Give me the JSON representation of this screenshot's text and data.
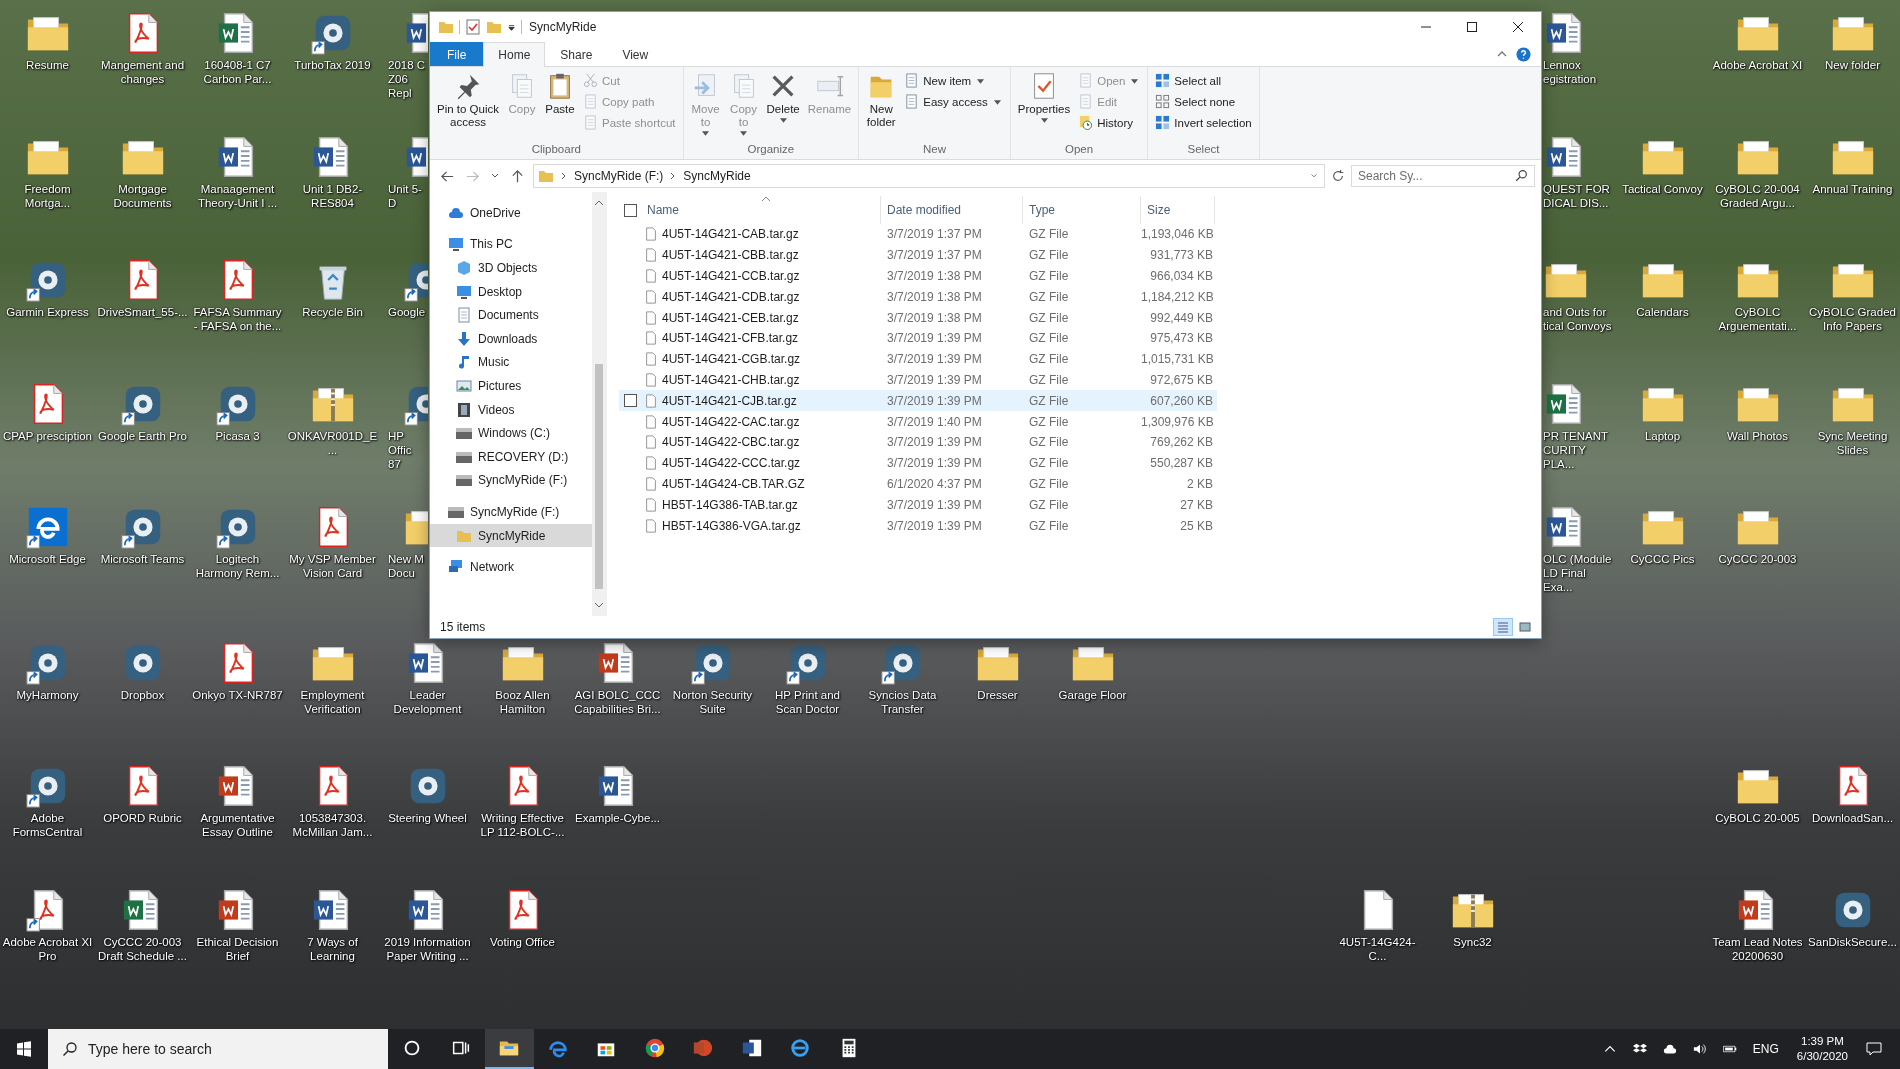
{
  "desktop": {
    "icons": [
      {
        "label": "Resume",
        "kind": "folder",
        "shortcut": false
      },
      {
        "label": "Freedom Mortga...",
        "kind": "folder",
        "shortcut": false
      },
      {
        "label": "Garmin Express",
        "kind": "app",
        "shortcut": true
      },
      {
        "label": "CPAP presciption",
        "kind": "pdf",
        "shortcut": false
      },
      {
        "label": "Microsoft Edge",
        "kind": "edge",
        "shortcut": true
      },
      {
        "label": "MyHarmony",
        "kind": "app",
        "shortcut": true
      },
      {
        "label": "Adobe FormsCentral",
        "kind": "app",
        "shortcut": true
      },
      {
        "label": "Adobe Acrobat XI Pro",
        "kind": "acrobat",
        "shortcut": true
      },
      {
        "label": "Mangement and changes",
        "kind": "pdf",
        "shortcut": false
      },
      {
        "label": "Mortgage Documents",
        "kind": "folder",
        "shortcut": false
      },
      {
        "label": "DriveSmart_55-...",
        "kind": "pdf",
        "shortcut": false
      },
      {
        "label": "Google Earth Pro",
        "kind": "app",
        "shortcut": true
      },
      {
        "label": "Microsoft Teams",
        "kind": "app",
        "shortcut": true
      },
      {
        "label": "Dropbox",
        "kind": "app",
        "shortcut": false
      },
      {
        "label": "OPORD Rubric",
        "kind": "pdf",
        "shortcut": false
      },
      {
        "label": "CyCCC 20-003 Draft Schedule ...",
        "kind": "excel",
        "shortcut": false
      },
      {
        "label": "160408-1 C7 Carbon Par...",
        "kind": "excel",
        "shortcut": false
      },
      {
        "label": "Manaagement Theory-Unit I ...",
        "kind": "word",
        "shortcut": false
      },
      {
        "label": "FAFSA Summary - FAFSA on the...",
        "kind": "pdf",
        "shortcut": false
      },
      {
        "label": "Picasa 3",
        "kind": "app",
        "shortcut": true
      },
      {
        "label": "Logitech Harmony Rem...",
        "kind": "app",
        "shortcut": true
      },
      {
        "label": "Onkyo TX-NR787",
        "kind": "pdf",
        "shortcut": false
      },
      {
        "label": "Argumentative Essay Outline",
        "kind": "slides",
        "shortcut": false
      },
      {
        "label": "Ethical Decision Brief",
        "kind": "slides",
        "shortcut": false
      },
      {
        "label": "TurboTax 2019",
        "kind": "app",
        "shortcut": true
      },
      {
        "label": "Unit 1 DB2-RES804",
        "kind": "word",
        "shortcut": false
      },
      {
        "label": "Recycle Bin",
        "kind": "bin",
        "shortcut": false
      },
      {
        "label": "ONKAVR001D_E...",
        "kind": "zip",
        "shortcut": false
      },
      {
        "label": "My VSP Member Vision Card",
        "kind": "pdf",
        "shortcut": false
      },
      {
        "label": "Employment Verification",
        "kind": "folder",
        "shortcut": false
      },
      {
        "label": "1053847303. McMillan Jam...",
        "kind": "pdf",
        "shortcut": false
      },
      {
        "label": "7 Ways of Learning",
        "kind": "word",
        "shortcut": false
      },
      {
        "label": "2018 C\nZ06 Repl",
        "kind": "word",
        "shortcut": false
      },
      {
        "label": "Unit 5-D",
        "kind": "word",
        "shortcut": false
      },
      {
        "label": "Google",
        "kind": "app",
        "shortcut": true
      },
      {
        "label": "HP Offic\n87",
        "kind": "app",
        "shortcut": true
      },
      {
        "label": "New M\nDocu",
        "kind": "folder",
        "shortcut": false
      },
      {
        "label": "Leader Development",
        "kind": "word",
        "shortcut": false
      },
      {
        "label": "Steering Wheel",
        "kind": "app",
        "shortcut": false
      },
      {
        "label": "2019 Information Paper Writing ...",
        "kind": "word",
        "shortcut": false
      },
      {
        "label": "Booz Allen Hamilton",
        "kind": "folder",
        "shortcut": false
      },
      {
        "label": "Writing Effective LP 112-BOLC-...",
        "kind": "pdf",
        "shortcut": false
      },
      {
        "label": "Voting Office",
        "kind": "pdf",
        "shortcut": false
      },
      {
        "label": "AGI BOLC_CCC Capabilities Bri...",
        "kind": "slides",
        "shortcut": false
      },
      {
        "label": "Example-Cybe...",
        "kind": "word",
        "shortcut": false
      },
      {
        "label": "Norton Security Suite",
        "kind": "app",
        "shortcut": true
      },
      {
        "label": "HP Print and Scan Doctor",
        "kind": "app",
        "shortcut": true
      },
      {
        "label": "Syncios Data Transfer",
        "kind": "app",
        "shortcut": true
      },
      {
        "label": "Dresser",
        "kind": "folder",
        "shortcut": false
      },
      {
        "label": "Garage Floor",
        "kind": "folder",
        "shortcut": false
      },
      {
        "label": "4U5T-14G424-C...",
        "kind": "file",
        "shortcut": false
      },
      {
        "label": "Sync32",
        "kind": "zip",
        "shortcut": false
      },
      {
        "label": "Lennox\negistration",
        "kind": "word",
        "shortcut": false
      },
      {
        "label": "QUEST FOR\nDICAL DIS...",
        "kind": "word",
        "shortcut": false
      },
      {
        "label": "and Outs for\ntical Convoys",
        "kind": "folder",
        "shortcut": false
      },
      {
        "label": "PR TENANT\nCURITY PLA...",
        "kind": "excel",
        "shortcut": false
      },
      {
        "label": "OLC (Module\nLD Final Exa...",
        "kind": "word",
        "shortcut": false
      },
      {
        "label": "Adobe Acrobat XI",
        "kind": "folder",
        "shortcut": false
      },
      {
        "label": "New folder",
        "kind": "folder",
        "shortcut": false
      },
      {
        "label": "Tactical Convoy",
        "kind": "folder",
        "shortcut": false
      },
      {
        "label": "CyBOLC 20-004 Graded Argu...",
        "kind": "folder",
        "shortcut": false
      },
      {
        "label": "Annual Training",
        "kind": "folder",
        "shortcut": false
      },
      {
        "label": "Calendars",
        "kind": "folder",
        "shortcut": false
      },
      {
        "label": "CyBOLC Arguementati...",
        "kind": "folder",
        "shortcut": false
      },
      {
        "label": "CyBOLC Graded Info Papers",
        "kind": "folder",
        "shortcut": false
      },
      {
        "label": "Laptop",
        "kind": "folder",
        "shortcut": false
      },
      {
        "label": "Wall Photos",
        "kind": "folder",
        "shortcut": false
      },
      {
        "label": "Sync Meeting Slides",
        "kind": "folder",
        "shortcut": false
      },
      {
        "label": "CyCCC Pics",
        "kind": "folder",
        "shortcut": false
      },
      {
        "label": "CyCCC 20-003",
        "kind": "folder",
        "shortcut": false
      },
      {
        "label": "CyBOLC 20-005",
        "kind": "folder",
        "shortcut": false
      },
      {
        "label": "DownloadSan...",
        "kind": "pdf",
        "shortcut": false
      },
      {
        "label": "Team Lead Notes 20200630",
        "kind": "slides",
        "shortcut": false
      },
      {
        "label": "SanDiskSecure...",
        "kind": "app",
        "shortcut": false
      }
    ]
  },
  "explorer": {
    "title": "SyncMyRide",
    "ribbon_tabs": [
      {
        "label": "File",
        "kind": "menu",
        "selected": false
      },
      {
        "label": "Home",
        "kind": "tab",
        "selected": true
      },
      {
        "label": "Share",
        "kind": "tab",
        "selected": false
      },
      {
        "label": "View",
        "kind": "tab",
        "selected": false
      }
    ],
    "ribbon_groups": [
      {
        "label": "Clipboard",
        "commands": [
          {
            "label": "Pin to Quick\naccess",
            "kind": "large",
            "dropdown": false,
            "disabled": false
          },
          {
            "label": "Copy",
            "kind": "large",
            "dropdown": false,
            "disabled": true
          },
          {
            "label": "Paste",
            "kind": "large",
            "dropdown": false,
            "disabled": false
          },
          {
            "label": "Cut",
            "kind": "small",
            "dropdown": false,
            "disabled": true
          },
          {
            "label": "Copy path",
            "kind": "small",
            "dropdown": false,
            "disabled": true
          },
          {
            "label": "Paste shortcut",
            "kind": "small",
            "dropdown": false,
            "disabled": true
          }
        ]
      },
      {
        "label": "Organize",
        "commands": [
          {
            "label": "Move\nto",
            "kind": "large",
            "dropdown": true,
            "disabled": true
          },
          {
            "label": "Copy\nto",
            "kind": "large",
            "dropdown": true,
            "disabled": true
          },
          {
            "label": "Delete",
            "kind": "large",
            "dropdown": true,
            "disabled": false
          },
          {
            "label": "Rename",
            "kind": "large",
            "dropdown": false,
            "disabled": true
          }
        ]
      },
      {
        "label": "New",
        "commands": [
          {
            "label": "New\nfolder",
            "kind": "large",
            "dropdown": false,
            "disabled": false
          },
          {
            "label": "New item",
            "kind": "small",
            "dropdown": true,
            "disabled": false
          },
          {
            "label": "Easy access",
            "kind": "small",
            "dropdown": true,
            "disabled": false
          }
        ]
      },
      {
        "label": "Open",
        "commands": [
          {
            "label": "Properties",
            "kind": "large",
            "dropdown": true,
            "disabled": false
          },
          {
            "label": "Open",
            "kind": "small",
            "dropdown": true,
            "disabled": true
          },
          {
            "label": "Edit",
            "kind": "small",
            "dropdown": false,
            "disabled": true
          },
          {
            "label": "History",
            "kind": "small",
            "dropdown": false,
            "disabled": false
          }
        ]
      },
      {
        "label": "Select",
        "commands": [
          {
            "label": "Select all",
            "kind": "small",
            "dropdown": false,
            "disabled": false
          },
          {
            "label": "Select none",
            "kind": "small",
            "dropdown": false,
            "disabled": false
          },
          {
            "label": "Invert selection",
            "kind": "small",
            "dropdown": false,
            "disabled": false
          }
        ]
      }
    ],
    "address": {
      "path": [
        "SyncMyRide (F:)",
        "SyncMyRide"
      ]
    },
    "search": {
      "placeholder": "Search Sy..."
    },
    "nav": [
      {
        "label": "OneDrive",
        "selected": false
      },
      {
        "label": "This PC",
        "selected": false,
        "children": [
          {
            "label": "3D Objects",
            "selected": false
          },
          {
            "label": "Desktop",
            "selected": false
          },
          {
            "label": "Documents",
            "selected": false
          },
          {
            "label": "Downloads",
            "selected": false
          },
          {
            "label": "Music",
            "selected": false
          },
          {
            "label": "Pictures",
            "selected": false
          },
          {
            "label": "Videos",
            "selected": false
          },
          {
            "label": "Windows (C:)",
            "selected": false
          },
          {
            "label": "RECOVERY (D:)",
            "selected": false
          },
          {
            "label": "SyncMyRide (F:)",
            "selected": false
          }
        ]
      },
      {
        "label": "SyncMyRide (F:)",
        "selected": false,
        "children": [
          {
            "label": "SyncMyRide",
            "selected": true
          }
        ]
      },
      {
        "label": "Network",
        "selected": false
      }
    ],
    "select_all": {
      "checked": false
    },
    "columns": [
      {
        "label": "Name",
        "sorted": true
      },
      {
        "label": "Date modified",
        "sorted": false
      },
      {
        "label": "Type",
        "sorted": false
      },
      {
        "label": "Size",
        "sorted": false
      }
    ],
    "files": [
      {
        "name": "4U5T-14G421-CAB.tar.gz",
        "date": "3/7/2019 1:37 PM",
        "type": "GZ File",
        "size": "1,193,046 KB",
        "selected": false
      },
      {
        "name": "4U5T-14G421-CBB.tar.gz",
        "date": "3/7/2019 1:37 PM",
        "type": "GZ File",
        "size": "931,773 KB",
        "selected": false
      },
      {
        "name": "4U5T-14G421-CCB.tar.gz",
        "date": "3/7/2019 1:38 PM",
        "type": "GZ File",
        "size": "966,034 KB",
        "selected": false
      },
      {
        "name": "4U5T-14G421-CDB.tar.gz",
        "date": "3/7/2019 1:38 PM",
        "type": "GZ File",
        "size": "1,184,212 KB",
        "selected": false
      },
      {
        "name": "4U5T-14G421-CEB.tar.gz",
        "date": "3/7/2019 1:38 PM",
        "type": "GZ File",
        "size": "992,449 KB",
        "selected": false
      },
      {
        "name": "4U5T-14G421-CFB.tar.gz",
        "date": "3/7/2019 1:39 PM",
        "type": "GZ File",
        "size": "975,473 KB",
        "selected": false
      },
      {
        "name": "4U5T-14G421-CGB.tar.gz",
        "date": "3/7/2019 1:39 PM",
        "type": "GZ File",
        "size": "1,015,731 KB",
        "selected": false
      },
      {
        "name": "4U5T-14G421-CHB.tar.gz",
        "date": "3/7/2019 1:39 PM",
        "type": "GZ File",
        "size": "972,675 KB",
        "selected": false
      },
      {
        "name": "4U5T-14G421-CJB.tar.gz",
        "date": "3/7/2019 1:39 PM",
        "type": "GZ File",
        "size": "607,260 KB",
        "selected": true
      },
      {
        "name": "4U5T-14G422-CAC.tar.gz",
        "date": "3/7/2019 1:40 PM",
        "type": "GZ File",
        "size": "1,309,976 KB",
        "selected": false
      },
      {
        "name": "4U5T-14G422-CBC.tar.gz",
        "date": "3/7/2019 1:39 PM",
        "type": "GZ File",
        "size": "769,262 KB",
        "selected": false
      },
      {
        "name": "4U5T-14G422-CCC.tar.gz",
        "date": "3/7/2019 1:39 PM",
        "type": "GZ File",
        "size": "550,287 KB",
        "selected": false
      },
      {
        "name": "4U5T-14G424-CB.TAR.GZ",
        "date": "6/1/2020 4:37 PM",
        "type": "GZ File",
        "size": "2 KB",
        "selected": false
      },
      {
        "name": "HB5T-14G386-TAB.tar.gz",
        "date": "3/7/2019 1:39 PM",
        "type": "GZ File",
        "size": "27 KB",
        "selected": false
      },
      {
        "name": "HB5T-14G386-VGA.tar.gz",
        "date": "3/7/2019 1:39 PM",
        "type": "GZ File",
        "size": "25 KB",
        "selected": false
      }
    ],
    "status": "15 items",
    "views": [
      {
        "selected": true
      },
      {
        "selected": false
      }
    ]
  },
  "taskbar": {
    "search": {
      "placeholder": "Type here to search"
    },
    "apps": [
      {
        "active": false
      },
      {
        "active": false
      },
      {
        "active": true
      },
      {
        "active": false
      },
      {
        "active": false
      },
      {
        "active": false
      },
      {
        "active": false
      },
      {
        "active": false
      },
      {
        "active": false
      },
      {
        "active": false
      }
    ],
    "tray": {
      "language": "ENG",
      "time": "1:39 PM",
      "date": "6/30/2020"
    }
  }
}
